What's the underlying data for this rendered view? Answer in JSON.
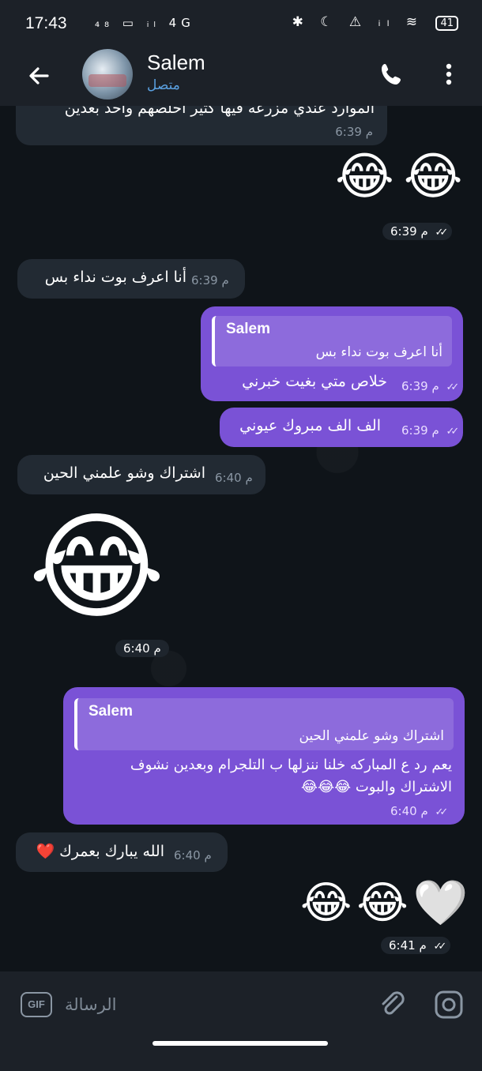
{
  "status_bar": {
    "time": "17:43",
    "left_icons": "₄₈ ▭ ᵢₗ 4G",
    "right_icons": "✱ ☾ ⚠ ᵢₗ ≋",
    "battery": "41"
  },
  "header": {
    "name": "Salem",
    "status": "متصل"
  },
  "messages": [
    {
      "dir": "in",
      "text": "الموارد عندي مزرعه فيها كثير اخلصهم واخد بعدين",
      "time": "6:39 م"
    },
    {
      "dir": "out",
      "emoji": "😂😂",
      "time": "6:39 م"
    },
    {
      "dir": "in",
      "text": "أنا اعرف بوت نداء بس",
      "time": "6:39 م"
    },
    {
      "dir": "out",
      "quote_name": "Salem",
      "quote_text": "أنا اعرف بوت نداء بس",
      "text": "خلاص متي بغيت خبرني",
      "time": "6:39 م"
    },
    {
      "dir": "out",
      "text": "الف الف مبروك عيوني",
      "time": "6:39 م"
    },
    {
      "dir": "in",
      "text": "اشتراك وشو علمني الحين",
      "time": "6:40 م"
    },
    {
      "dir": "in",
      "emoji": "😂",
      "time": "6:40 م"
    },
    {
      "dir": "out",
      "quote_name": "Salem",
      "quote_text": "اشتراك وشو علمني الحين",
      "text_line1": "يعم رد ع المباركه خلنا ننزلها ب التلجرام وبعدين نشوف",
      "text_line2": "الاشتراك والبوت 😂😂😂",
      "time": "6:40 م"
    },
    {
      "dir": "in",
      "text": "الله يبارك بعمرك ❤️",
      "time": "6:40 م"
    },
    {
      "dir": "out",
      "emoji": "😂😂🤍",
      "time": "6:41 م"
    }
  ],
  "ticks": "✓✓",
  "input": {
    "gif_label": "GIF",
    "placeholder": "الرسالة"
  },
  "icons": {
    "back": "back-arrow-icon",
    "call": "phone-icon",
    "menu": "more-vertical-icon",
    "attach": "paperclip-icon",
    "camera": "camera-icon",
    "gif": "gif-icon"
  }
}
